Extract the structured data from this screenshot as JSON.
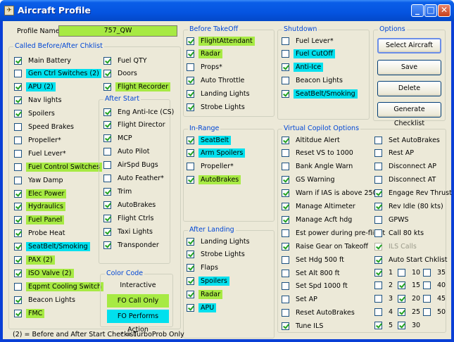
{
  "window": {
    "title": "Aircraft Profile",
    "minimize": "_",
    "maximize": "□",
    "close": "✕",
    "icon": "aircraft-icon"
  },
  "profile": {
    "label": "Profile Name",
    "value": "757_QW"
  },
  "groups": {
    "called": "Called Before/After Chklist",
    "afterstart": "After Start",
    "colorcode": "Color Code",
    "beforetakeoff": "Before TakeOff",
    "inrange": "In-Range",
    "afterlanding": "After Landing",
    "shutdown": "Shutdown",
    "options": "Options",
    "copilot": "Virtual Copilot Options"
  },
  "called_col1": [
    {
      "label": "Main Battery",
      "checked": true,
      "hl": ""
    },
    {
      "label": "Gen Ctrl Switches (2)",
      "checked": false,
      "hl": "cyan"
    },
    {
      "label": "APU (2)",
      "checked": true,
      "hl": "cyan"
    },
    {
      "label": "Nav lights",
      "checked": true,
      "hl": ""
    },
    {
      "label": "Spoilers",
      "checked": true,
      "hl": ""
    },
    {
      "label": "Speed Brakes",
      "checked": false,
      "hl": ""
    },
    {
      "label": "Propeller*",
      "checked": false,
      "hl": ""
    },
    {
      "label": "Fuel Lever*",
      "checked": false,
      "hl": ""
    },
    {
      "label": "Fuel Control Switches",
      "checked": false,
      "hl": "green"
    },
    {
      "label": "Yaw Damp",
      "checked": false,
      "hl": ""
    },
    {
      "label": "Elec Power",
      "checked": true,
      "hl": "green"
    },
    {
      "label": "Hydraulics",
      "checked": true,
      "hl": "green"
    },
    {
      "label": "Fuel Panel",
      "checked": true,
      "hl": "green"
    },
    {
      "label": "Probe Heat",
      "checked": true,
      "hl": ""
    },
    {
      "label": "SeatBelt/Smoking",
      "checked": true,
      "hl": "cyan"
    },
    {
      "label": "PAX (2)",
      "checked": true,
      "hl": "green"
    },
    {
      "label": "ISO Valve (2)",
      "checked": true,
      "hl": "green"
    },
    {
      "label": "Eqpmt Cooling Switch",
      "checked": false,
      "hl": "green"
    },
    {
      "label": "Beacon Lights",
      "checked": true,
      "hl": ""
    },
    {
      "label": "FMC",
      "checked": true,
      "hl": "green"
    }
  ],
  "called_col2": [
    {
      "label": "Fuel QTY",
      "checked": true,
      "hl": ""
    },
    {
      "label": "Doors",
      "checked": true,
      "hl": ""
    },
    {
      "label": "Flight Recorder",
      "checked": true,
      "hl": "green"
    }
  ],
  "afterstart_items": [
    {
      "label": "Eng Anti-Ice (CS)",
      "checked": true,
      "hl": ""
    },
    {
      "label": "Flight Director",
      "checked": true,
      "hl": ""
    },
    {
      "label": "MCP",
      "checked": true,
      "hl": ""
    },
    {
      "label": "Auto Pilot",
      "checked": false,
      "hl": ""
    },
    {
      "label": "AirSpd Bugs",
      "checked": false,
      "hl": ""
    },
    {
      "label": "Auto Feather*",
      "checked": false,
      "hl": ""
    },
    {
      "label": "Trim",
      "checked": true,
      "hl": ""
    },
    {
      "label": "AutoBrakes",
      "checked": true,
      "hl": ""
    },
    {
      "label": "Flight Ctrls",
      "checked": true,
      "hl": ""
    },
    {
      "label": "Taxi Lights",
      "checked": true,
      "hl": ""
    },
    {
      "label": "Transponder",
      "checked": true,
      "hl": ""
    }
  ],
  "colorcode": {
    "interactive": "Interactive",
    "fo_call": "FO Call Only",
    "fo_perform": "FO Performs Action",
    "green": "#a7ea43",
    "cyan": "#00e0ee"
  },
  "beforetakeoff_items": [
    {
      "label": "FlightAttendant",
      "checked": true,
      "hl": "green"
    },
    {
      "label": "Radar",
      "checked": true,
      "hl": "green"
    },
    {
      "label": "Props*",
      "checked": false,
      "hl": ""
    },
    {
      "label": "Auto Throttle",
      "checked": true,
      "hl": ""
    },
    {
      "label": "Landing Lights",
      "checked": true,
      "hl": ""
    },
    {
      "label": "Strobe Lights",
      "checked": true,
      "hl": ""
    }
  ],
  "inrange_items": [
    {
      "label": "SeatBelt",
      "checked": true,
      "hl": "cyan"
    },
    {
      "label": "Arm Spoilers",
      "checked": true,
      "hl": "cyan"
    },
    {
      "label": "Propeller*",
      "checked": false,
      "hl": ""
    },
    {
      "label": "AutoBrakes",
      "checked": true,
      "hl": "green"
    }
  ],
  "afterlanding_items": [
    {
      "label": "Landing Lights",
      "checked": true,
      "hl": ""
    },
    {
      "label": "Strobe Lights",
      "checked": true,
      "hl": ""
    },
    {
      "label": "Flaps",
      "checked": true,
      "hl": ""
    },
    {
      "label": "Spoilers",
      "checked": true,
      "hl": "cyan"
    },
    {
      "label": "Radar",
      "checked": true,
      "hl": "green"
    },
    {
      "label": "APU",
      "checked": true,
      "hl": "cyan"
    }
  ],
  "shutdown_items": [
    {
      "label": "Fuel Lever*",
      "checked": false,
      "hl": ""
    },
    {
      "label": "Fuel CutOff",
      "checked": false,
      "hl": "cyan"
    },
    {
      "label": "Anti-Ice",
      "checked": true,
      "hl": "cyan"
    },
    {
      "label": "Beacon Lights",
      "checked": false,
      "hl": ""
    },
    {
      "label": "SeatBelt/Smoking",
      "checked": true,
      "hl": "cyan"
    }
  ],
  "options_buttons": [
    "Select Aircraft",
    "Save",
    "Delete",
    "Generate Checklist"
  ],
  "copilot_col1": [
    {
      "label": "Altitdue Alert",
      "checked": true,
      "hl": ""
    },
    {
      "label": "Reset VS to 1000",
      "checked": false,
      "hl": ""
    },
    {
      "label": "Bank Angle Warn",
      "checked": false,
      "hl": ""
    },
    {
      "label": "GS Warning",
      "checked": true,
      "hl": ""
    },
    {
      "label": "Warn if IAS is above 250",
      "checked": true,
      "hl": ""
    },
    {
      "label": "Manage Altimeter",
      "checked": true,
      "hl": ""
    },
    {
      "label": "Manage Acft hdg",
      "checked": true,
      "hl": ""
    },
    {
      "label": "Est power during pre-flight",
      "checked": false,
      "hl": ""
    },
    {
      "label": "Raise Gear on Takeoff",
      "checked": true,
      "hl": ""
    },
    {
      "label": "Set Hdg 500 ft",
      "checked": false,
      "hl": ""
    },
    {
      "label": "Set Alt  800 ft",
      "checked": false,
      "hl": ""
    },
    {
      "label": "Set Spd 1000 ft",
      "checked": false,
      "hl": ""
    },
    {
      "label": "Set AP",
      "checked": false,
      "hl": ""
    },
    {
      "label": "Reset AutoBrakes",
      "checked": false,
      "hl": ""
    },
    {
      "label": "Tune ILS",
      "checked": true,
      "hl": ""
    }
  ],
  "copilot_col2": [
    {
      "label": "Set AutoBrakes",
      "checked": false,
      "hl": "",
      "dis": false
    },
    {
      "label": "Rest AP",
      "checked": false,
      "hl": "",
      "dis": false
    },
    {
      "label": "Disconnect AP",
      "checked": false,
      "hl": "",
      "dis": false
    },
    {
      "label": "Disconnect AT",
      "checked": false,
      "hl": "",
      "dis": false
    },
    {
      "label": "Engage Rev Thrust",
      "checked": true,
      "hl": "",
      "dis": false
    },
    {
      "label": "Rev Idle (80 kts)",
      "checked": true,
      "hl": "",
      "dis": false
    },
    {
      "label": "GPWS",
      "checked": false,
      "hl": "",
      "dis": false
    },
    {
      "label": "Call 80 kts",
      "checked": false,
      "hl": "",
      "dis": false
    },
    {
      "label": "ILS Calls",
      "checked": true,
      "hl": "",
      "dis": true
    },
    {
      "label": "Auto Start Chklist",
      "checked": true,
      "hl": "",
      "dis": false
    }
  ],
  "autostart": [
    [
      {
        "label": "1",
        "checked": true
      },
      {
        "label": "10",
        "checked": false
      },
      {
        "label": "35",
        "checked": false
      }
    ],
    [
      {
        "label": "2",
        "checked": false
      },
      {
        "label": "15",
        "checked": true
      },
      {
        "label": "40",
        "checked": false
      }
    ],
    [
      {
        "label": "3",
        "checked": false
      },
      {
        "label": "20",
        "checked": true
      },
      {
        "label": "45",
        "checked": false
      }
    ],
    [
      {
        "label": "4",
        "checked": false
      },
      {
        "label": "25",
        "checked": true
      },
      {
        "label": "50",
        "checked": false
      }
    ],
    [
      {
        "label": "5",
        "checked": true
      },
      {
        "label": "30",
        "checked": true
      }
    ]
  ],
  "footnotes": {
    "left": "(2) = Before and After Start Checkist",
    "right": "* = TurboProb Only"
  }
}
